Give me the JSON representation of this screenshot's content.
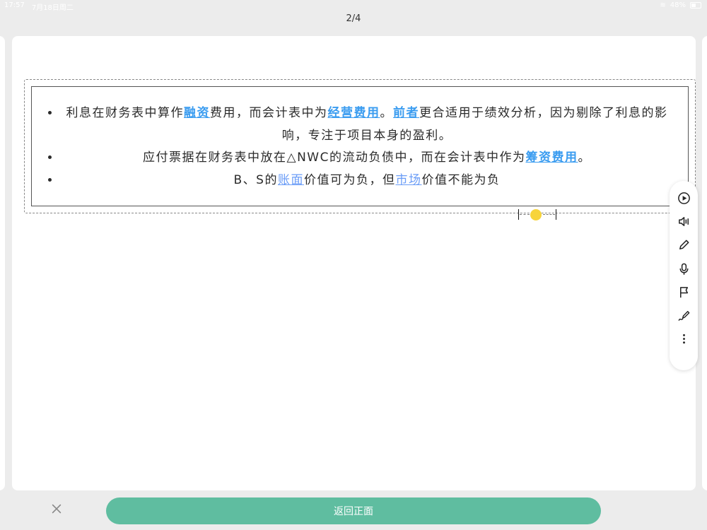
{
  "status_bar": {
    "time": "17:57",
    "date": "7月18日周二",
    "battery": "48%"
  },
  "page_counter": "2/4",
  "card": {
    "bullets": [
      {
        "segments": [
          {
            "text": "利息在财务表中算作",
            "link": false
          },
          {
            "text": "融资",
            "link": true
          },
          {
            "text": "费用，而会计表中为",
            "link": false
          },
          {
            "text": "经营费用",
            "link": true
          },
          {
            "text": "。",
            "link": false
          },
          {
            "text": "前者",
            "link": true
          },
          {
            "text": "更合适用于绩效分析，因为剔除了利息的影响，专注于项目本身的盈利。",
            "link": false
          }
        ]
      },
      {
        "segments": [
          {
            "text": "应付票据在财务表中放在△NWC的流动负债中，而在会计表中作为",
            "link": false
          },
          {
            "text": "筹资费用",
            "link": true
          },
          {
            "text": "。",
            "link": false
          }
        ]
      },
      {
        "segments": [
          {
            "text": "B、S的",
            "link": false
          },
          {
            "text": "账面",
            "link": true
          },
          {
            "text": "价值可为负，但",
            "link": false
          },
          {
            "text": "市场",
            "link": true
          },
          {
            "text": "价值不能为负",
            "link": false
          }
        ]
      }
    ]
  },
  "toolbar": {
    "items": [
      {
        "name": "play-icon"
      },
      {
        "name": "speaker-icon"
      },
      {
        "name": "pencil-icon"
      },
      {
        "name": "microphone-icon"
      },
      {
        "name": "flag-icon"
      },
      {
        "name": "pen-draw-icon"
      },
      {
        "name": "more-icon"
      }
    ]
  },
  "bottom": {
    "close_label": "×",
    "return_label": "返回正面"
  },
  "colors": {
    "accent": "#5fbda0",
    "link": "#3a9cf0",
    "marker": "#f7d43a"
  }
}
